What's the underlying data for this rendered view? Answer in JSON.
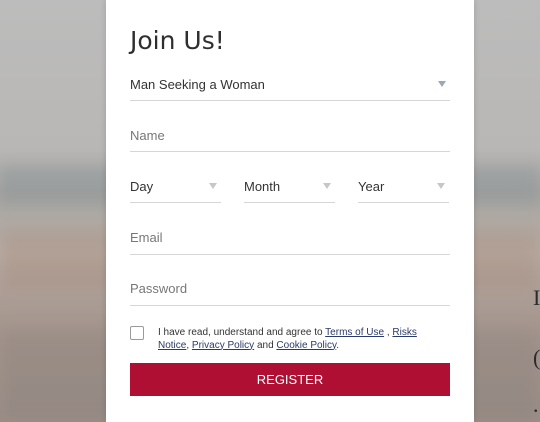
{
  "form": {
    "title": "Join Us!",
    "seeking_value": "Man Seeking a Woman",
    "name_placeholder": "Name",
    "day_label": "Day",
    "month_label": "Month",
    "year_label": "Year",
    "email_placeholder": "Email",
    "password_placeholder": "Password",
    "agree": {
      "prefix": "I have read, understand and agree to ",
      "terms_link": "Terms of Use",
      "sep1": " , ",
      "risks_link": "Risks Notice",
      "sep2": ", ",
      "privacy_link": "Privacy Policy",
      "sep3": " and ",
      "cookie_link": "Cookie Policy",
      "suffix": "."
    },
    "register_label": "REGISTER"
  },
  "background": {
    "right_edge_glyphs": [
      "I",
      "(",
      "."
    ]
  },
  "colors": {
    "accent": "#ae0f33",
    "link": "#2a3a6a",
    "caret": "#9aa7b6"
  }
}
